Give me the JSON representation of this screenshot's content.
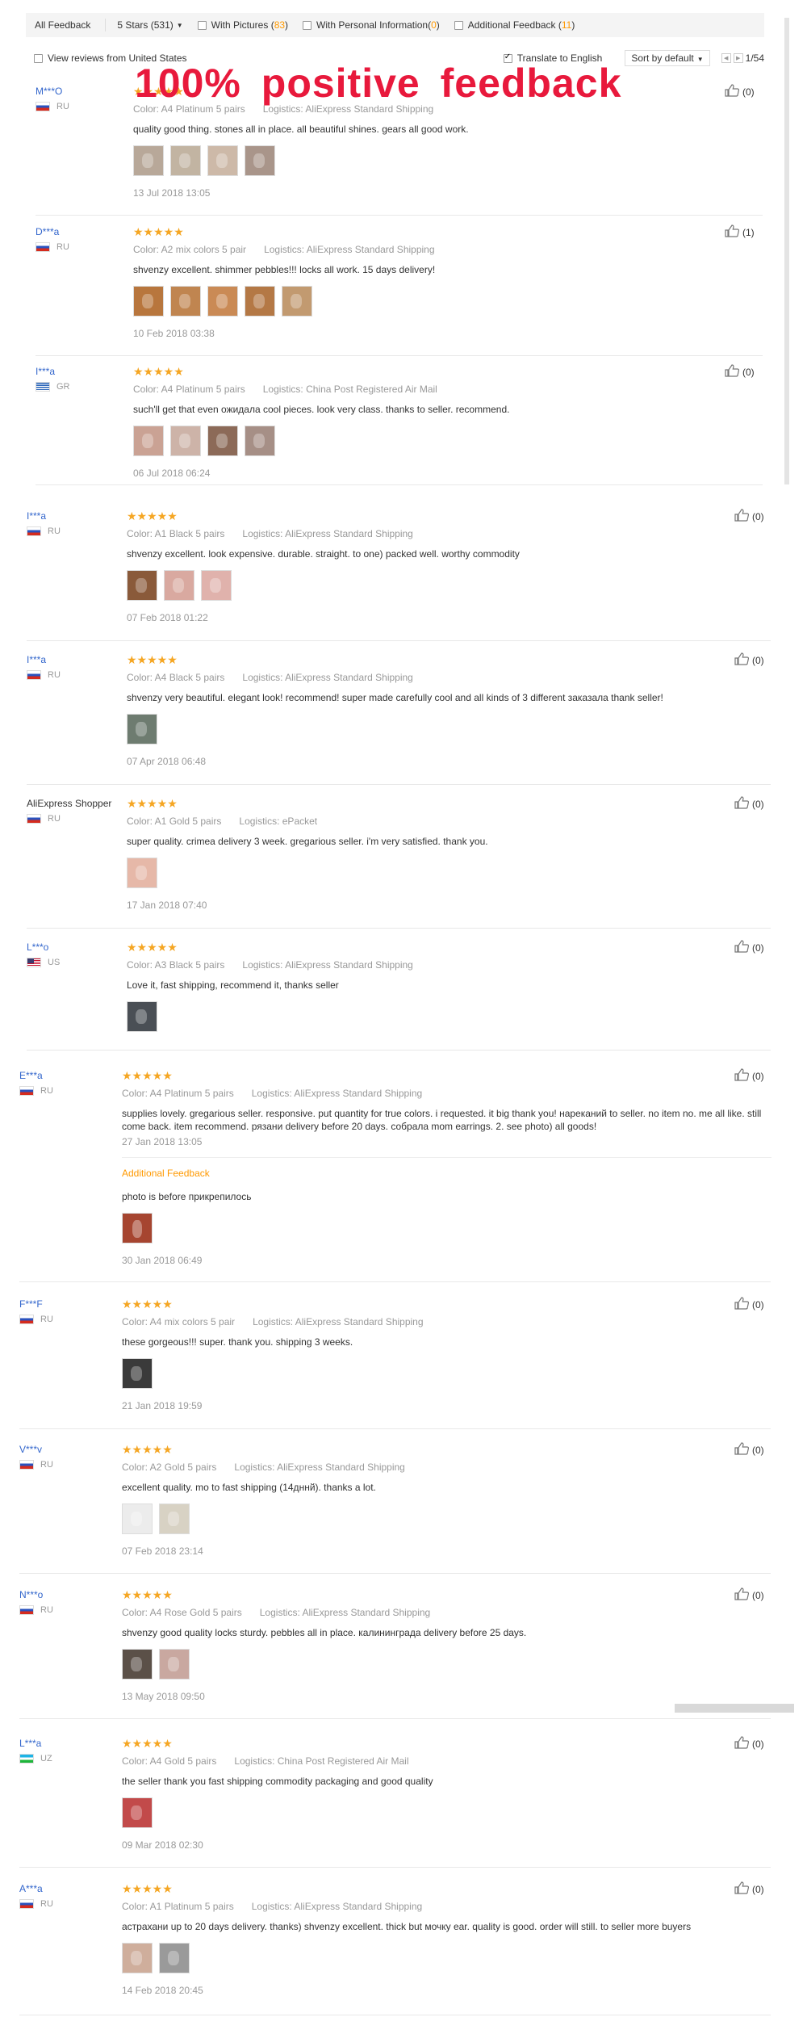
{
  "filters": {
    "all_feedback": "All Feedback",
    "stars_select": "5 Stars (531)",
    "with_pictures_label": "With Pictures (",
    "with_pictures_count": "83",
    "with_personal_label": "With Personal Information(",
    "with_personal_count": "0",
    "additional_label": "Additional Feedback (",
    "additional_count": "11",
    "close_paren": ")",
    "view_us_label": "View reviews from United States",
    "translate_label": "Translate to English",
    "sort_label": "Sort by default",
    "page_indicator": "1/54"
  },
  "headline": "100% positive feedback",
  "reviews": [
    {
      "user": "M***O",
      "country": "RU",
      "color": "Color: A4 Platinum 5 pairs",
      "logistics": "Logistics: AliExpress Standard Shipping",
      "text": "quality good thing. stones all in place. all beautiful shines. gears all good work.",
      "date": "13 Jul 2018 13:05",
      "likes": "(0)"
    },
    {
      "user": "D***a",
      "country": "RU",
      "color": "Color: A2 mix colors 5 pair",
      "logistics": "Logistics: AliExpress Standard Shipping",
      "text": "shvenzy excellent. shimmer pebbles!!! locks all work. 15 days delivery!",
      "date": "10 Feb 2018 03:38",
      "likes": "(1)"
    },
    {
      "user": "I***a",
      "country": "GR",
      "color": "Color: A4 Platinum 5 pairs",
      "logistics": "Logistics: China Post Registered Air Mail",
      "text": "such'll get that even ожидала cool pieces. look very class. thanks to seller. recommend.",
      "date": "06 Jul 2018 06:24",
      "likes": "(0)"
    },
    {
      "user": "I***a",
      "country": "RU",
      "color": "Color: A1 Black 5 pairs",
      "logistics": "Logistics: AliExpress Standard Shipping",
      "text": "shvenzy excellent. look expensive. durable. straight. to one) packed well. worthy commodity",
      "date": "07 Feb 2018 01:22",
      "likes": "(0)"
    },
    {
      "user": "I***a",
      "country": "RU",
      "color": "Color: A4 Black 5 pairs",
      "logistics": "Logistics: AliExpress Standard Shipping",
      "text": "shvenzy very beautiful. elegant look! recommend! super made carefully cool and all kinds of 3 different заказала thank seller!",
      "date": "07 Apr 2018 06:48",
      "likes": "(0)"
    },
    {
      "user": "AliExpress Shopper",
      "country": "RU",
      "color": "Color: A1 Gold 5 pairs",
      "logistics": "Logistics: ePacket",
      "text": "super quality. crimea delivery 3 week. gregarious seller. i'm very satisfied. thank you.",
      "date": "17 Jan 2018 07:40",
      "likes": "(0)"
    },
    {
      "user": "L***o",
      "country": "US",
      "color": "Color: A3 Black 5 pairs",
      "logistics": "Logistics: AliExpress Standard Shipping",
      "text": "Love it, fast shipping, recommend it, thanks seller",
      "date": "",
      "likes": "(0)"
    },
    {
      "user": "E***a",
      "country": "RU",
      "color": "Color: A4 Platinum 5 pairs",
      "logistics": "Logistics: AliExpress Standard Shipping",
      "text": "supplies lovely. gregarious seller. responsive. put quantity for true colors. i requested. it big thank you! нареканий to seller. no item no. me all like. still come back. item recommend. рязани delivery before 20 days. собрала mom earrings. 2. see photo) all goods!",
      "date": "27 Jan 2018 13:05",
      "additional_title": "Additional Feedback",
      "additional_text": "photo is before прикрепилось",
      "additional_date": "30 Jan 2018 06:49",
      "likes": "(0)"
    },
    {
      "user": "F***F",
      "country": "RU",
      "color": "Color: A4 mix colors 5 pair",
      "logistics": "Logistics: AliExpress Standard Shipping",
      "text": "these gorgeous!!! super. thank you. shipping 3 weeks.",
      "date": "21 Jan 2018 19:59",
      "likes": "(0)"
    },
    {
      "user": "V***v",
      "country": "RU",
      "color": "Color: A2 Gold 5 pairs",
      "logistics": "Logistics: AliExpress Standard Shipping",
      "text": "excellent quality. mo to fast shipping (14дннй). thanks a lot.",
      "date": "07 Feb 2018 23:14",
      "likes": "(0)"
    },
    {
      "user": "N***o",
      "country": "RU",
      "color": "Color: A4 Rose Gold 5 pairs",
      "logistics": "Logistics: AliExpress Standard Shipping",
      "text": "shvenzy good quality locks sturdy. pebbles all in place. калининграда delivery before 25 days.",
      "date": "13 May 2018 09:50",
      "likes": "(0)"
    },
    {
      "user": "L***a",
      "country": "UZ",
      "color": "Color: A4 Gold 5 pairs",
      "logistics": "Logistics: China Post Registered Air Mail",
      "text": "the seller thank you fast shipping commodity packaging and good quality",
      "date": "09 Mar 2018 02:30",
      "likes": "(0)"
    },
    {
      "user": "A***a",
      "country": "RU",
      "color": "Color: A1 Platinum 5 pairs",
      "logistics": "Logistics: AliExpress Standard Shipping",
      "text": "астрахани up to 20 days delivery. thanks) shvenzy excellent. thick but мочку ear. quality is good. order will still. to seller more buyers",
      "date": "14 Feb 2018 20:45",
      "likes": "(0)"
    }
  ],
  "stars_glyph": "★★★★★"
}
